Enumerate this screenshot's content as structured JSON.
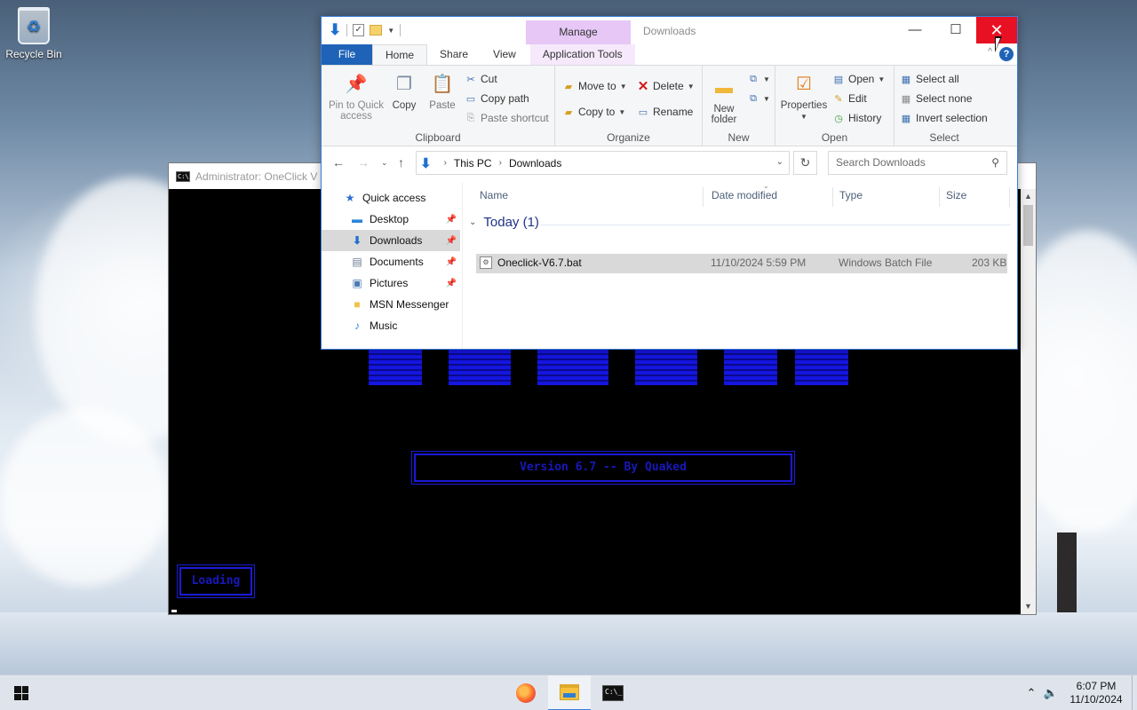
{
  "desktop": {
    "icons": [
      {
        "label": "Recycle Bin",
        "icon": "recycle-bin-icon"
      }
    ]
  },
  "console": {
    "title": "Administrator:  OneClick V",
    "version_text": "Version 6.7 -- By Quaked",
    "loading_text": "Loading"
  },
  "explorer": {
    "window_title": "Downloads",
    "contextual_tab": "Manage",
    "tabs": {
      "file": "File",
      "home": "Home",
      "share": "Share",
      "view": "View",
      "app_tools": "Application Tools"
    },
    "clipboard": {
      "pin": "Pin to Quick access",
      "copy": "Copy",
      "paste": "Paste",
      "cut": "Cut",
      "copy_path": "Copy path",
      "paste_shortcut": "Paste shortcut",
      "label": "Clipboard"
    },
    "organize": {
      "move_to": "Move to",
      "copy_to": "Copy to",
      "delete": "Delete",
      "rename": "Rename",
      "label": "Organize"
    },
    "new": {
      "new_folder": "New folder",
      "label": "New"
    },
    "open": {
      "properties": "Properties",
      "open": "Open",
      "edit": "Edit",
      "history": "History",
      "label": "Open"
    },
    "select": {
      "select_all": "Select all",
      "select_none": "Select none",
      "invert": "Invert selection",
      "label": "Select"
    },
    "address": {
      "parts": [
        "This PC",
        "Downloads"
      ]
    },
    "search_placeholder": "Search Downloads",
    "nav": [
      {
        "label": "Quick access",
        "icon": "star-icon"
      },
      {
        "label": "Desktop",
        "icon": "desktop-icon",
        "pinned": true
      },
      {
        "label": "Downloads",
        "icon": "download-icon",
        "pinned": true,
        "selected": true
      },
      {
        "label": "Documents",
        "icon": "document-icon",
        "pinned": true
      },
      {
        "label": "Pictures",
        "icon": "picture-icon",
        "pinned": true
      },
      {
        "label": "MSN Messenger",
        "icon": "folder-icon"
      },
      {
        "label": "Music",
        "icon": "music-icon"
      }
    ],
    "columns": {
      "name": "Name",
      "date": "Date modified",
      "type": "Type",
      "size": "Size"
    },
    "group_header": "Today (1)",
    "files": [
      {
        "name": "Oneclick-V6.7.bat",
        "date": "11/10/2024 5:59 PM",
        "type": "Windows Batch File",
        "size": "203 KB"
      }
    ]
  },
  "taskbar": {
    "apps": [
      {
        "name": "firefox",
        "icon": "firefox-icon"
      },
      {
        "name": "file-explorer",
        "icon": "file-explorer-icon",
        "active": true
      },
      {
        "name": "command-prompt",
        "icon": "cmd-icon"
      }
    ],
    "time": "6:07 PM",
    "date": "11/10/2024"
  }
}
